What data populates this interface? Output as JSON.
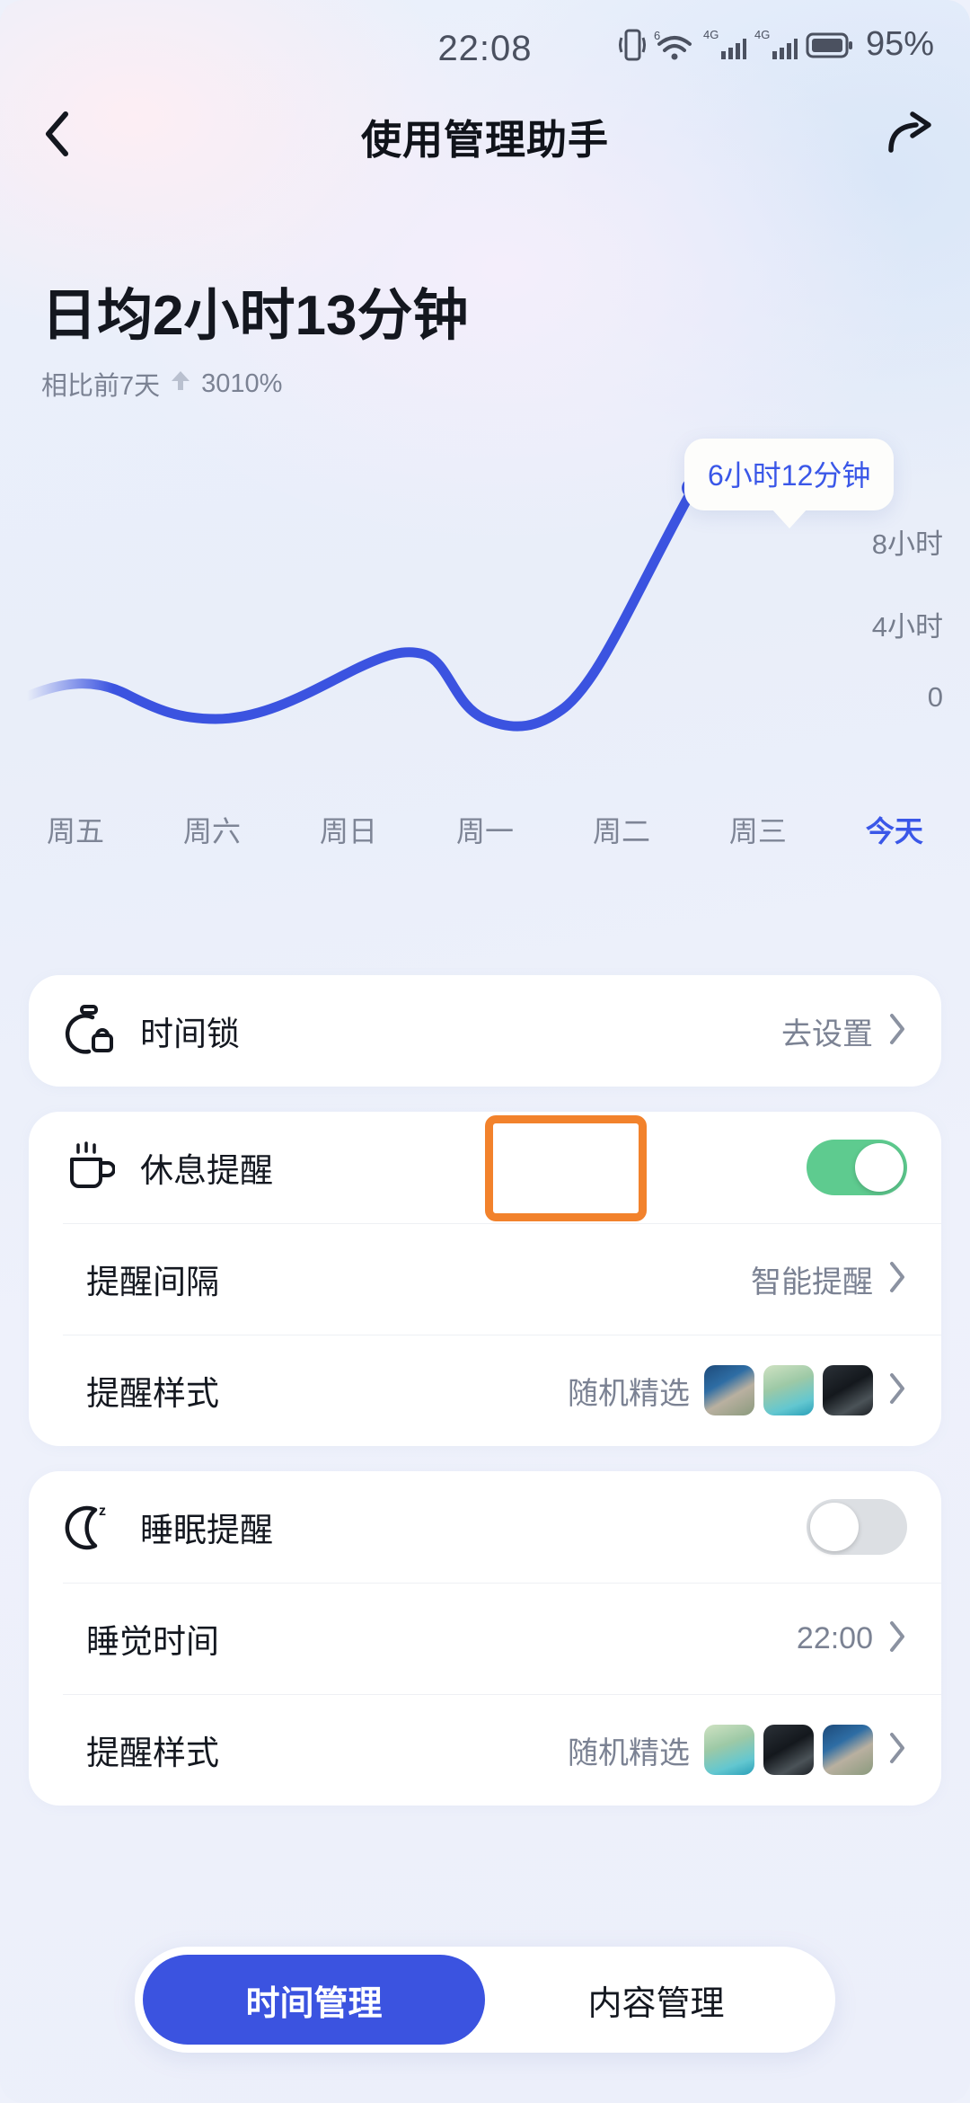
{
  "status_bar": {
    "time": "22:08",
    "battery_percent": "95%",
    "icons": [
      "vibrate-icon",
      "wifi6plus-icon",
      "signal-4g-icon",
      "signal-4g-icon",
      "battery-icon"
    ],
    "network_label_1": "4G",
    "network_label_2": "4G",
    "wifi_label": "6",
    "text_color": "#4b5160"
  },
  "nav": {
    "back_icon": "chevron-left-icon",
    "title": "使用管理助手",
    "share_icon": "share-arrow-icon"
  },
  "summary": {
    "headline": "日均2小时13分钟",
    "compare_label": "相比前7天",
    "trend_icon": "arrow-up-icon",
    "change_percent": "3010%"
  },
  "chart_data": {
    "type": "line",
    "title": "",
    "xlabel": "",
    "ylabel": "",
    "categories": [
      "周五",
      "周六",
      "周日",
      "周一",
      "周二",
      "周三",
      "今天"
    ],
    "values": [
      1.55,
      0.85,
      1.6,
      2.45,
      0.7,
      1.3,
      6.2
    ],
    "unit": "小时",
    "ylim": [
      0,
      8
    ],
    "yticks": [
      8,
      4,
      0
    ],
    "ytick_labels": [
      "8小时",
      "4小时",
      "0"
    ],
    "grid": false,
    "legend": "none",
    "line_color": "#3b53e0",
    "highlight_index": 6,
    "highlight_label": "今天",
    "tooltip": "6小时12分钟",
    "tooltip_text_color": "#3a57e8",
    "active_tick_color": "#3a57e8"
  },
  "settings": {
    "time_lock": {
      "icon": "stopwatch-lock-icon",
      "label": "时间锁",
      "value": "去设置",
      "chevron": "chevron-right-icon"
    },
    "break_reminder": {
      "icon": "coffee-cup-icon",
      "label": "休息提醒",
      "toggle": "on",
      "toggle_color": "#5ecb8f",
      "rows": [
        {
          "label": "提醒间隔",
          "value": "智能提醒",
          "chevron": "chevron-right-icon",
          "thumbs": 0
        },
        {
          "label": "提醒样式",
          "value": "随机精选",
          "chevron": "chevron-right-icon",
          "thumbs": 3
        }
      ]
    },
    "sleep_reminder": {
      "icon": "moon-z-icon",
      "label": "睡眠提醒",
      "toggle": "off",
      "toggle_color": "#dcdfe3",
      "rows": [
        {
          "label": "睡觉时间",
          "value": "22:00",
          "chevron": "chevron-right-icon",
          "thumbs": 0
        },
        {
          "label": "提醒样式",
          "value": "随机精选",
          "chevron": "chevron-right-icon",
          "thumbs": 3
        }
      ]
    }
  },
  "annotation": {
    "shape": "rectangle-highlight",
    "color": "#f2822c",
    "target": "break-reminder-toggle"
  },
  "tabs": [
    {
      "label": "时间管理",
      "active": true
    },
    {
      "label": "内容管理",
      "active": false
    }
  ]
}
